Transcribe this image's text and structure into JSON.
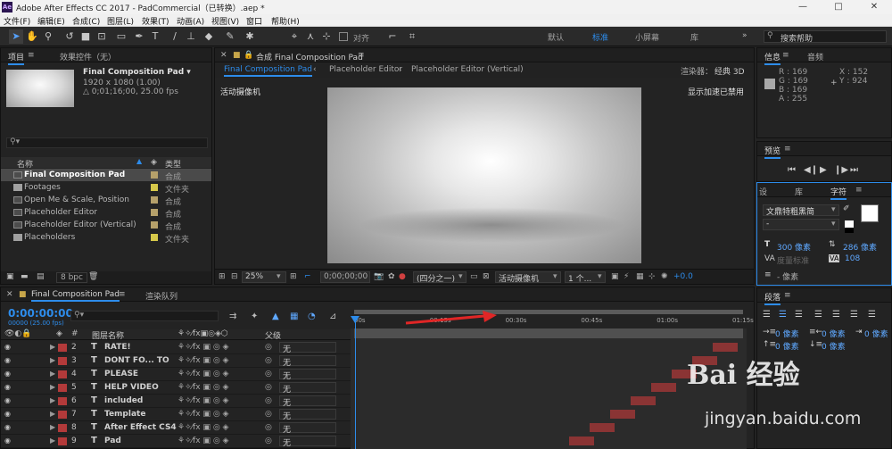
{
  "app": {
    "title": "Adobe After Effects CC 2017 - PadCommercial（已转换）.aep *",
    "logo": "Ae",
    "window_controls": [
      "—",
      "□",
      "✕"
    ]
  },
  "menu": [
    "文件(F)",
    "编辑(E)",
    "合成(C)",
    "图层(L)",
    "效果(T)",
    "动画(A)",
    "视图(V)",
    "窗口",
    "帮助(H)"
  ],
  "toolbar": {
    "snap_label": "对齐",
    "workspaces": [
      "默认",
      "标准",
      "小屏幕",
      "库"
    ],
    "selected_workspace": "标准",
    "search_placeholder": "搜索帮助"
  },
  "project": {
    "tab_project": "项目",
    "tab_effects": "效果控件（无）",
    "comp_name": "Final Composition Pad ▾",
    "comp_res": "1920 x 1080 (1.00)",
    "comp_duration": "△ 0;01;16;00, 25.00 fps",
    "col_name": "名称",
    "col_type": "类型",
    "items": [
      {
        "name": "Final Composition Pad",
        "type": "合成",
        "kind": "comp",
        "tag": "#b5a06a",
        "selected": true
      },
      {
        "name": "Footages",
        "type": "文件夹",
        "kind": "folder",
        "tag": "#d6c84a",
        "selected": false
      },
      {
        "name": "Open Me & Scale, Position",
        "type": "合成",
        "kind": "comp",
        "tag": "#b5a06a",
        "selected": false
      },
      {
        "name": "Placeholder Editor",
        "type": "合成",
        "kind": "comp",
        "tag": "#b5a06a",
        "selected": false
      },
      {
        "name": "Placeholder Editor (Vertical)",
        "type": "合成",
        "kind": "comp",
        "tag": "#b5a06a",
        "selected": false
      },
      {
        "name": "Placeholders",
        "type": "文件夹",
        "kind": "folder",
        "tag": "#d6c84a",
        "selected": false
      }
    ],
    "bpc": "8 bpc"
  },
  "comp": {
    "header_title": "合成 Final Composition Pad",
    "tabs": [
      "Final Composition Pad",
      "Placeholder Editor",
      "Placeholder Editor (Vertical)"
    ],
    "renderer_label": "渲染器：",
    "renderer_value": "经典 3D",
    "camera_label": "活动摄像机",
    "accel_label": "显示加速已禁用",
    "zoom": "25%",
    "timecode": "0;00;00;00",
    "resolution": "(四分之一)",
    "view_camera": "活动摄像机",
    "views": "1 个...",
    "exposure": "+0.0"
  },
  "info": {
    "tab_info": "信息",
    "tab_audio": "音频",
    "r": "R : 169",
    "g": "G : 169",
    "b": "B : 169",
    "a": "A : 255",
    "x": "X : 152",
    "y": "Y : 924"
  },
  "preview": {
    "title": "预览"
  },
  "character": {
    "tabs": [
      "设",
      "库",
      "字符"
    ],
    "font": "文鼎特粗黑简",
    "size": "300 像素",
    "leading": "286 像素",
    "kerning": "度量标准",
    "tracking": "108",
    "stroke": "- 像素"
  },
  "paragraph": {
    "title": "段落",
    "indent_left": "0 像素",
    "indent_right": "0 像素",
    "indent_first": "0 像素",
    "space_before": "0 像素",
    "space_after": "0 像素"
  },
  "timeline": {
    "tab_comp": "Final Composition Pad",
    "tab_render": "渲染队列",
    "time": "0:00:00:00",
    "fps": "00000 (25.00 fps)",
    "col_layer": "图层名称",
    "col_parent": "父级",
    "col_num": "#",
    "ticks": [
      "00s",
      "00:15s",
      "00:30s",
      "00:45s",
      "01:00s",
      "01:15s"
    ],
    "parent_none": "无",
    "layers": [
      {
        "num": "2",
        "name": "RATE!"
      },
      {
        "num": "3",
        "name": "DONT FO... TO"
      },
      {
        "num": "4",
        "name": "PLEASE"
      },
      {
        "num": "5",
        "name": "HELP VIDEO"
      },
      {
        "num": "6",
        "name": "included"
      },
      {
        "num": "7",
        "name": "Template"
      },
      {
        "num": "8",
        "name": "After Effect CS4"
      },
      {
        "num": "9",
        "name": "Pad"
      }
    ],
    "bar_start_seconds": [
      70,
      66,
      62,
      58,
      54,
      50,
      46,
      42
    ],
    "timeline_end_seconds": 76
  },
  "watermark": {
    "brand": "Bai  经验",
    "url": "jingyan.baidu.com"
  }
}
